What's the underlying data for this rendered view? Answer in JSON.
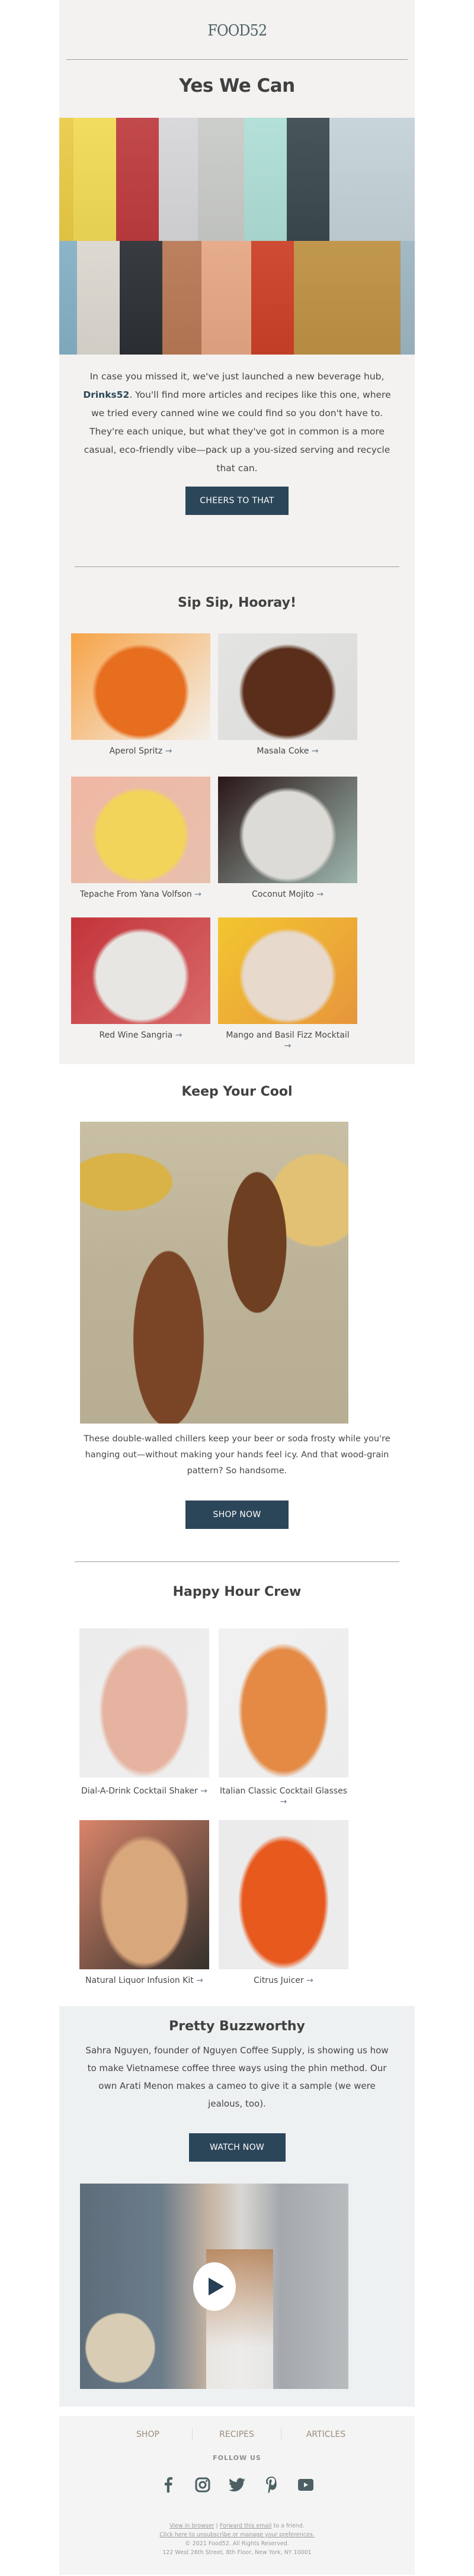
{
  "header": {
    "logo": "FOOD52"
  },
  "hero": {
    "title": "Yes We Can",
    "image_alt": "Assorted canned wines",
    "intro_before": "In case you missed it, we've just launched a new beverage hub, ",
    "intro_link": "Drinks52",
    "intro_after": ". You'll find more articles and recipes like this one, where we tried every canned wine we could find so you don't have to. They're each unique, but what they've got in common is a more casual, eco-friendly vibe—pack up a you-sized serving and recycle that can.",
    "button": "CHEERS TO THAT"
  },
  "recipes": {
    "title": "Sip Sip, Hooray!",
    "items": [
      {
        "label": "Aperol Spritz",
        "arrow": "→",
        "colors": [
          "#f7a347",
          "#e76d1f",
          "#f3efe9"
        ]
      },
      {
        "label": "Masala Coke",
        "arrow": "→",
        "colors": [
          "#e4e4e2",
          "#5a2e1a",
          "#dadad8"
        ]
      },
      {
        "label": "Tepache From Yana Volfson",
        "arrow": "→",
        "colors": [
          "#efb7a3",
          "#f2d45a",
          "#e8c0ae"
        ]
      },
      {
        "label": "Coconut Mojito",
        "arrow": "→",
        "colors": [
          "#2a1616",
          "#dcdbd6",
          "#9fb8b0"
        ]
      },
      {
        "label": "Red Wine Sangria",
        "arrow": "→",
        "colors": [
          "#c2343a",
          "#e8e6e2",
          "#d96a6a"
        ]
      },
      {
        "label": "Mango and Basil Fizz Mocktail",
        "arrow": "→",
        "colors": [
          "#f3c630",
          "#e7d9cc",
          "#e7953b"
        ]
      }
    ]
  },
  "keep_cool": {
    "title": "Keep Your Cool",
    "image_alt": "Wood-grain can chillers with dominoes",
    "text": "These double-walled chillers keep your beer or soda frosty while you're hanging out—without making your hands feel icy. And that wood-grain pattern? So handsome.",
    "button": "SHOP NOW"
  },
  "happy_hour": {
    "title": "Happy Hour Crew",
    "items": [
      {
        "label": "Dial-A-Drink Cocktail Shaker",
        "arrow": "→",
        "colors": [
          "#ececec",
          "#e6b3a0",
          "#efefef"
        ]
      },
      {
        "label": "Italian Classic Cocktail Glasses",
        "arrow": "→",
        "colors": [
          "#f1f1f1",
          "#e48a45",
          "#ececec"
        ]
      },
      {
        "label": "Natural Liquor Infusion Kit",
        "arrow": "→",
        "colors": [
          "#d9856a",
          "#d9a77c",
          "#33302c"
        ]
      },
      {
        "label": "Citrus Juicer",
        "arrow": "→",
        "colors": [
          "#ebebeb",
          "#e8591e",
          "#ececec"
        ]
      }
    ]
  },
  "buzzworthy": {
    "title": "Pretty Buzzworthy",
    "text": "Sahra Nguyen, founder of Nguyen Coffee Supply, is showing us how to make Vietnamese coffee three ways using the phin method. Our own Arati Menon makes a cameo to give it a sample (we were jealous, too).",
    "button": "WATCH NOW",
    "video_alt": "Pouring coffee over iced milk"
  },
  "footer": {
    "nav": [
      "SHOP",
      "RECIPES",
      "ARTICLES"
    ],
    "follow_label": "FOLLOW US",
    "social": [
      "facebook",
      "instagram",
      "twitter",
      "pinterest",
      "youtube"
    ],
    "view_in_browser": "View in browser",
    "separator": "|",
    "forward_link": "Forward this email",
    "forward_suffix": " to a friend.",
    "unsubscribe": "Click here to unsubscribe or manage your preferences.",
    "copyright": "© 2021 Food52. All Rights Reserved.",
    "address": "122 West 26th Street, 8th Floor, New York, NY 10001"
  },
  "colors": {
    "button": "#2c4659",
    "link": "#2c4657",
    "footer_nav": "#9c8c7c",
    "social_icon": "#4c6064"
  }
}
